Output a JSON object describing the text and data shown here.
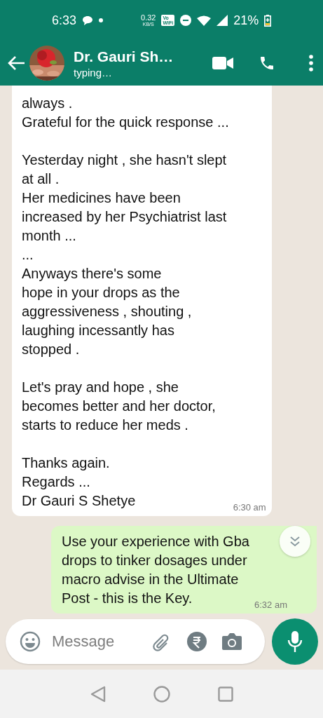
{
  "status_bar": {
    "time": "6:33",
    "data_rate": "0.32",
    "data_rate_unit": "KB/S",
    "network_badge": [
      "Vo",
      "WiFi"
    ],
    "battery": "21%"
  },
  "header": {
    "contact_name": "Dr. Gauri Sh…",
    "status": "typing…"
  },
  "messages": [
    {
      "kind": "incoming",
      "text": "always .\nGrateful for the quick response ...\n\nYesterday night , she hasn't slept\nat all .\nHer medicines have been\nincreased by her Psychiatrist last\nmonth ...\n...\nAnyways there's some\nhope in your drops as the\naggressiveness , shouting ,\nlaughing incessantly has\nstopped .\n\nLet's pray and hope , she\nbecomes better and her doctor,\nstarts to reduce her meds .\n\nThanks again.\nRegards ...\nDr Gauri S Shetye",
      "time": "6:30 am"
    },
    {
      "kind": "outgoing",
      "text": "Use your experience with Gba\ndrops to tinker dosages under\nmacro advise in the Ultimate\nPost - this is the Key.",
      "time": "6:32 am"
    }
  ],
  "composer": {
    "placeholder": "Message"
  }
}
